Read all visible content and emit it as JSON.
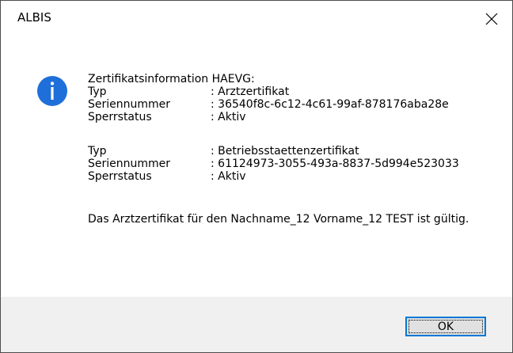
{
  "window": {
    "title": "ALBIS",
    "close_icon": "close-icon"
  },
  "message": {
    "icon": "info-icon",
    "heading": "Zertifikatsinformation HAEVG:",
    "certificates": [
      {
        "rows": [
          {
            "label": "Typ",
            "value": ": Arztzertifikat"
          },
          {
            "label": "Seriennummer",
            "value": ": 36540f8c-6c12-4c61-99af-878176aba28e"
          },
          {
            "label": "Sperrstatus",
            "value": ": Aktiv"
          }
        ]
      },
      {
        "rows": [
          {
            "label": "Typ",
            "value": ": Betriebsstaettenzertifikat"
          },
          {
            "label": "Seriennummer",
            "value": ": 61124973-3055-493a-8837-5d994e523033"
          },
          {
            "label": "Sperrstatus",
            "value": ": Aktiv"
          }
        ]
      }
    ],
    "footer": "Das Arztzertifikat für den Nachname_12 Vorname_12 TEST ist gültig."
  },
  "buttons": {
    "ok_label": "OK"
  },
  "colors": {
    "info_icon": "#1e6fd9",
    "button_border_focus": "#0078d7",
    "bottom_bar": "#f0f0f0"
  }
}
